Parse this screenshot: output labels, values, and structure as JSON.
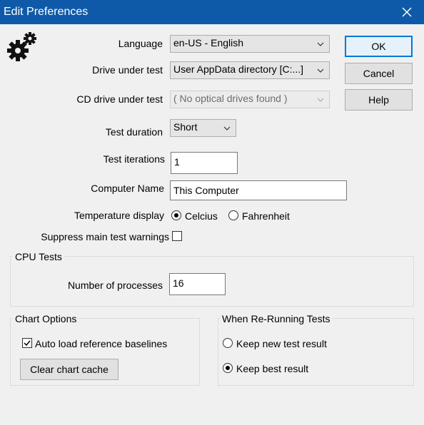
{
  "window": {
    "title": "Edit Preferences"
  },
  "buttons": {
    "ok": "OK",
    "cancel": "Cancel",
    "help": "Help",
    "clear_cache": "Clear chart cache"
  },
  "fields": {
    "language_label": "Language",
    "language_value": "en-US - English",
    "drive_label": "Drive under test",
    "drive_value": "User AppData directory [C:...]",
    "cd_label": "CD drive under test",
    "cd_value": "( No optical drives found )",
    "duration_label": "Test duration",
    "duration_value": "Short",
    "iterations_label": "Test iterations",
    "iterations_value": "1",
    "computer_name_label": "Computer Name",
    "computer_name_value": "This Computer",
    "temperature_label": "Temperature display",
    "temp_celcius": "Celcius",
    "temp_fahrenheit": "Fahrenheit",
    "temperature_selected": "Celcius",
    "suppress_label": "Suppress main test warnings",
    "suppress_checked": false
  },
  "cpu_tests": {
    "title": "CPU Tests",
    "processes_label": "Number of processes",
    "processes_value": "16"
  },
  "chart_options": {
    "title": "Chart Options",
    "auto_load_label": "Auto load reference baselines",
    "auto_load_checked": true
  },
  "rerun": {
    "title": "When Re-Running Tests",
    "keep_new": "Keep new test result",
    "keep_best": "Keep best result",
    "selected": "Keep best result"
  },
  "colors": {
    "titlebar": "#0f5aa8",
    "default_button_border": "#0078d7"
  }
}
